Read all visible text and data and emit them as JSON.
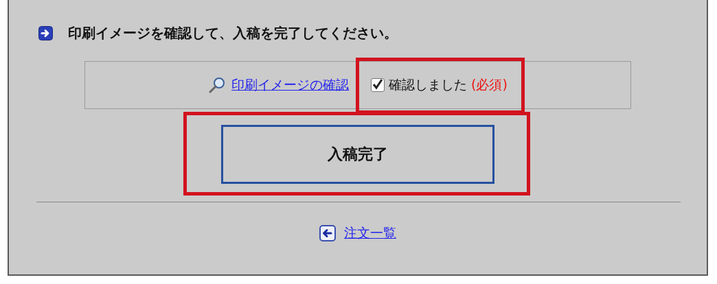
{
  "heading": "印刷イメージを確認して、入稿を完了してください。",
  "preview_link": "印刷イメージの確認",
  "confirm_checkbox": {
    "label": "確認しました",
    "required_note": "(必須)",
    "checked": true,
    "highlighted": true
  },
  "submit_button": {
    "label": "入稿完了",
    "highlighted": true
  },
  "back_link": "注文一覧"
}
